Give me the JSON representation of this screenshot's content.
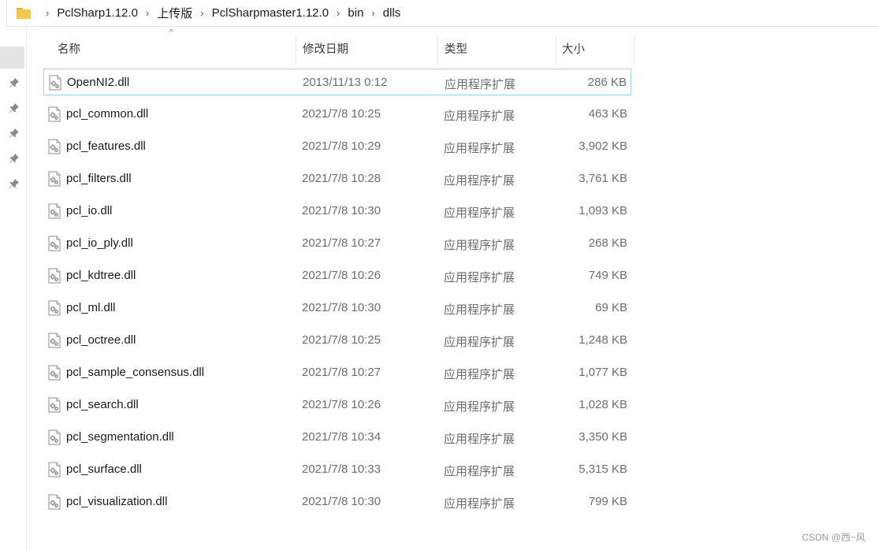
{
  "breadcrumb": {
    "folder_icon": "folder-icon",
    "items": [
      "PclSharp1.12.0",
      "上传版",
      "PclSharpmaster1.12.0",
      "bin",
      "dlls"
    ]
  },
  "nav": {
    "pin_icon": "pin-icon",
    "pin_count": 5
  },
  "columns": {
    "name": "名称",
    "date": "修改日期",
    "type": "类型",
    "size": "大小",
    "sort_indicator": "^"
  },
  "files": [
    {
      "name": "OpenNI2.dll",
      "date": "2013/11/13 0:12",
      "type": "应用程序扩展",
      "size": "286 KB"
    },
    {
      "name": "pcl_common.dll",
      "date": "2021/7/8 10:25",
      "type": "应用程序扩展",
      "size": "463 KB"
    },
    {
      "name": "pcl_features.dll",
      "date": "2021/7/8 10:29",
      "type": "应用程序扩展",
      "size": "3,902 KB"
    },
    {
      "name": "pcl_filters.dll",
      "date": "2021/7/8 10:28",
      "type": "应用程序扩展",
      "size": "3,761 KB"
    },
    {
      "name": "pcl_io.dll",
      "date": "2021/7/8 10:30",
      "type": "应用程序扩展",
      "size": "1,093 KB"
    },
    {
      "name": "pcl_io_ply.dll",
      "date": "2021/7/8 10:27",
      "type": "应用程序扩展",
      "size": "268 KB"
    },
    {
      "name": "pcl_kdtree.dll",
      "date": "2021/7/8 10:26",
      "type": "应用程序扩展",
      "size": "749 KB"
    },
    {
      "name": "pcl_ml.dll",
      "date": "2021/7/8 10:30",
      "type": "应用程序扩展",
      "size": "69 KB"
    },
    {
      "name": "pcl_octree.dll",
      "date": "2021/7/8 10:25",
      "type": "应用程序扩展",
      "size": "1,248 KB"
    },
    {
      "name": "pcl_sample_consensus.dll",
      "date": "2021/7/8 10:27",
      "type": "应用程序扩展",
      "size": "1,077 KB"
    },
    {
      "name": "pcl_search.dll",
      "date": "2021/7/8 10:26",
      "type": "应用程序扩展",
      "size": "1,028 KB"
    },
    {
      "name": "pcl_segmentation.dll",
      "date": "2021/7/8 10:34",
      "type": "应用程序扩展",
      "size": "3,350 KB"
    },
    {
      "name": "pcl_surface.dll",
      "date": "2021/7/8 10:33",
      "type": "应用程序扩展",
      "size": "5,315 KB"
    },
    {
      "name": "pcl_visualization.dll",
      "date": "2021/7/8 10:30",
      "type": "应用程序扩展",
      "size": "799 KB"
    }
  ],
  "file_icon": "dll-file-icon",
  "focused_row": 0,
  "colors": {
    "focus_border": "#99d1ff",
    "hover": "#e5f3ff",
    "folder": "#f5c84c",
    "muted_text": "#6d6d6d"
  },
  "watermark": "CSDN @西~风"
}
